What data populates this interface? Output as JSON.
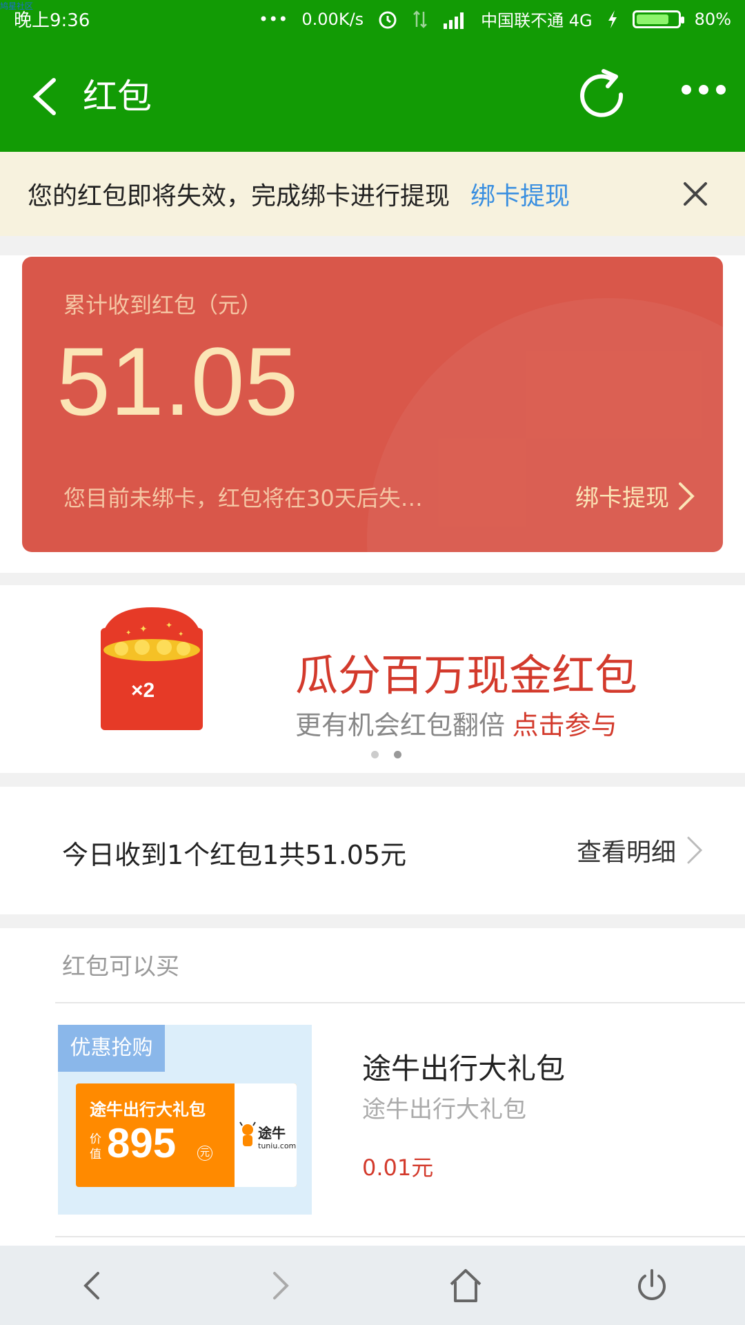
{
  "watermark": "鸠星社区",
  "status_bar": {
    "time": "晚上9:36",
    "network_speed": "0.00K/s",
    "carrier": "中国联不通 4G",
    "battery_percent": "80%",
    "battery_level": 0.8,
    "icons": [
      "more-dots-icon",
      "alarm-icon",
      "data-arrows-icon",
      "signal-icon",
      "charging-icon",
      "battery-icon"
    ]
  },
  "title_bar": {
    "title": "红包",
    "color": "#129b05"
  },
  "notice": {
    "text": "您的红包即将失效，完成绑卡进行提现",
    "link": "绑卡提现"
  },
  "card": {
    "label": "累计收到红包（元）",
    "amount": "51.05",
    "warning": "您目前未绑卡，红包将在30天后失…",
    "action": "绑卡提现",
    "color": "#d9574a"
  },
  "banner": {
    "badge": "×2",
    "title": "瓜分百万现金红包",
    "subtitle": "更有机会红包翻倍",
    "highlight": "点击参与",
    "total_pages": 2,
    "active_page": 2
  },
  "today": {
    "summary": "今日收到1个红包1共51.05元",
    "link": "查看明细"
  },
  "shop": {
    "heading": "红包可以买",
    "product": {
      "tag": "优惠抢购",
      "voucher_title": "途牛出行大礼包",
      "voucher_value_prefix": "价值",
      "voucher_value": "895",
      "voucher_unit": "元",
      "brand_cn": "途牛",
      "brand_en": "tuniu.com",
      "name": "途牛出行大礼包",
      "description": "途牛出行大礼包",
      "price": "0.01元"
    }
  }
}
